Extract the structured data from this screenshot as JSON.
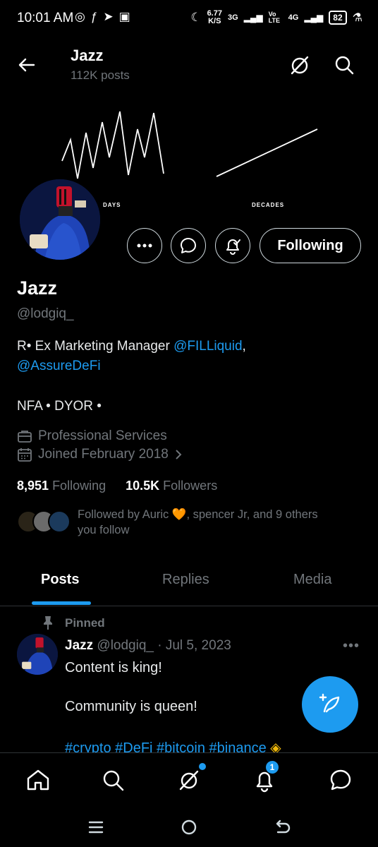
{
  "status_bar": {
    "time": "10:01 AM",
    "speed_value": "6.77",
    "speed_unit": "K/S",
    "net1": "3G",
    "net2": "Vo LTE",
    "net3": "4G",
    "battery": "82"
  },
  "header": {
    "title": "Jazz",
    "subtitle": "112K posts"
  },
  "banner": {
    "label_left": "DAYS",
    "label_right": "DECADES"
  },
  "actions": {
    "following_label": "Following"
  },
  "profile": {
    "name": "Jazz",
    "handle": "@lodgiq_",
    "bio_line1_prefix": "R• Ex Marketing Manager ",
    "bio_mention1": "@FILLiquid",
    "bio_line1_suffix": ",",
    "bio_mention2": "@AssureDeFi",
    "bio_line3": "NFA • DYOR •",
    "category": "Professional Services",
    "joined": "Joined February 2018",
    "following_count": "8,951",
    "following_label": "Following",
    "followers_count": "10.5K",
    "followers_label": "Followers",
    "followed_by_line1": "Followed by Auric 🧡, spencer Jr, and 9 others",
    "followed_by_line2": "you follow"
  },
  "tabs": [
    {
      "label": "Posts",
      "active": true
    },
    {
      "label": "Replies",
      "active": false
    },
    {
      "label": "Media",
      "active": false
    }
  ],
  "post": {
    "pinned_label": "Pinned",
    "author": "Jazz",
    "meta": " @lodgiq_ · Jul 5, 2023",
    "line1": "Content is king!",
    "line2": "Community is queen!",
    "line3_tags": "#crypto #DeFi #bitcoin #binance ",
    "line3_emoji": "◈"
  },
  "bottom_nav": {
    "notification_badge": "1"
  },
  "colors": {
    "accent": "#1d9bf0",
    "background": "#000000",
    "secondary_text": "#71767b",
    "primary_text": "#e7e9ea"
  }
}
